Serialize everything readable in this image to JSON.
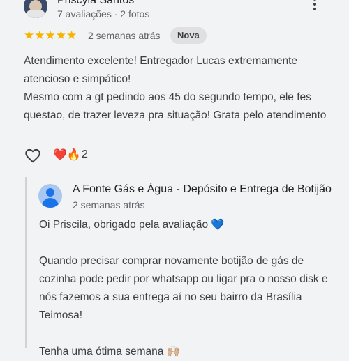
{
  "review": {
    "reviewer_name": "Priscyla Santos",
    "reviewer_meta": "7 avaliações · 2 fotos",
    "rating": "★★★★★",
    "time": "2 semanas atrás",
    "badge": "Nova",
    "text_lines": [
      "Atendimento excelente! Entregador Lucas extremamente atencioso e simpático!",
      "Mesmo com a gt pedindo aos 45 do segundo tempo, ele fes questao, de trazer leveza pra situação! Grata pelo atendimento"
    ],
    "reactions": "❤️🔥",
    "reaction_count": "2",
    "icons": {
      "more": "more-vert-icon",
      "like": "heart-outline-icon"
    }
  },
  "reply": {
    "owner_name": "A Fonte Gás e Água - Depósito e Entrega de Botijão",
    "time": "2 semanas atrás",
    "paragraph1": "Oi Priscila, obrigado pela avaliação 💙",
    "paragraph2": "Quando precisar comprar novamente botijão de gás de cozinha pode pedir por whatsapp ou ligar pra o nosso disk e nós fazemos a sua entrega aí no seu bairro da Brasília Teimosa!",
    "paragraph3": "Tenha uma ótima semana 🙌🏼"
  },
  "colors": {
    "background": "#f1f3f4",
    "star": "#f6b400",
    "secondary_text": "#5f6368",
    "badge_bg": "#e0e0e0"
  }
}
